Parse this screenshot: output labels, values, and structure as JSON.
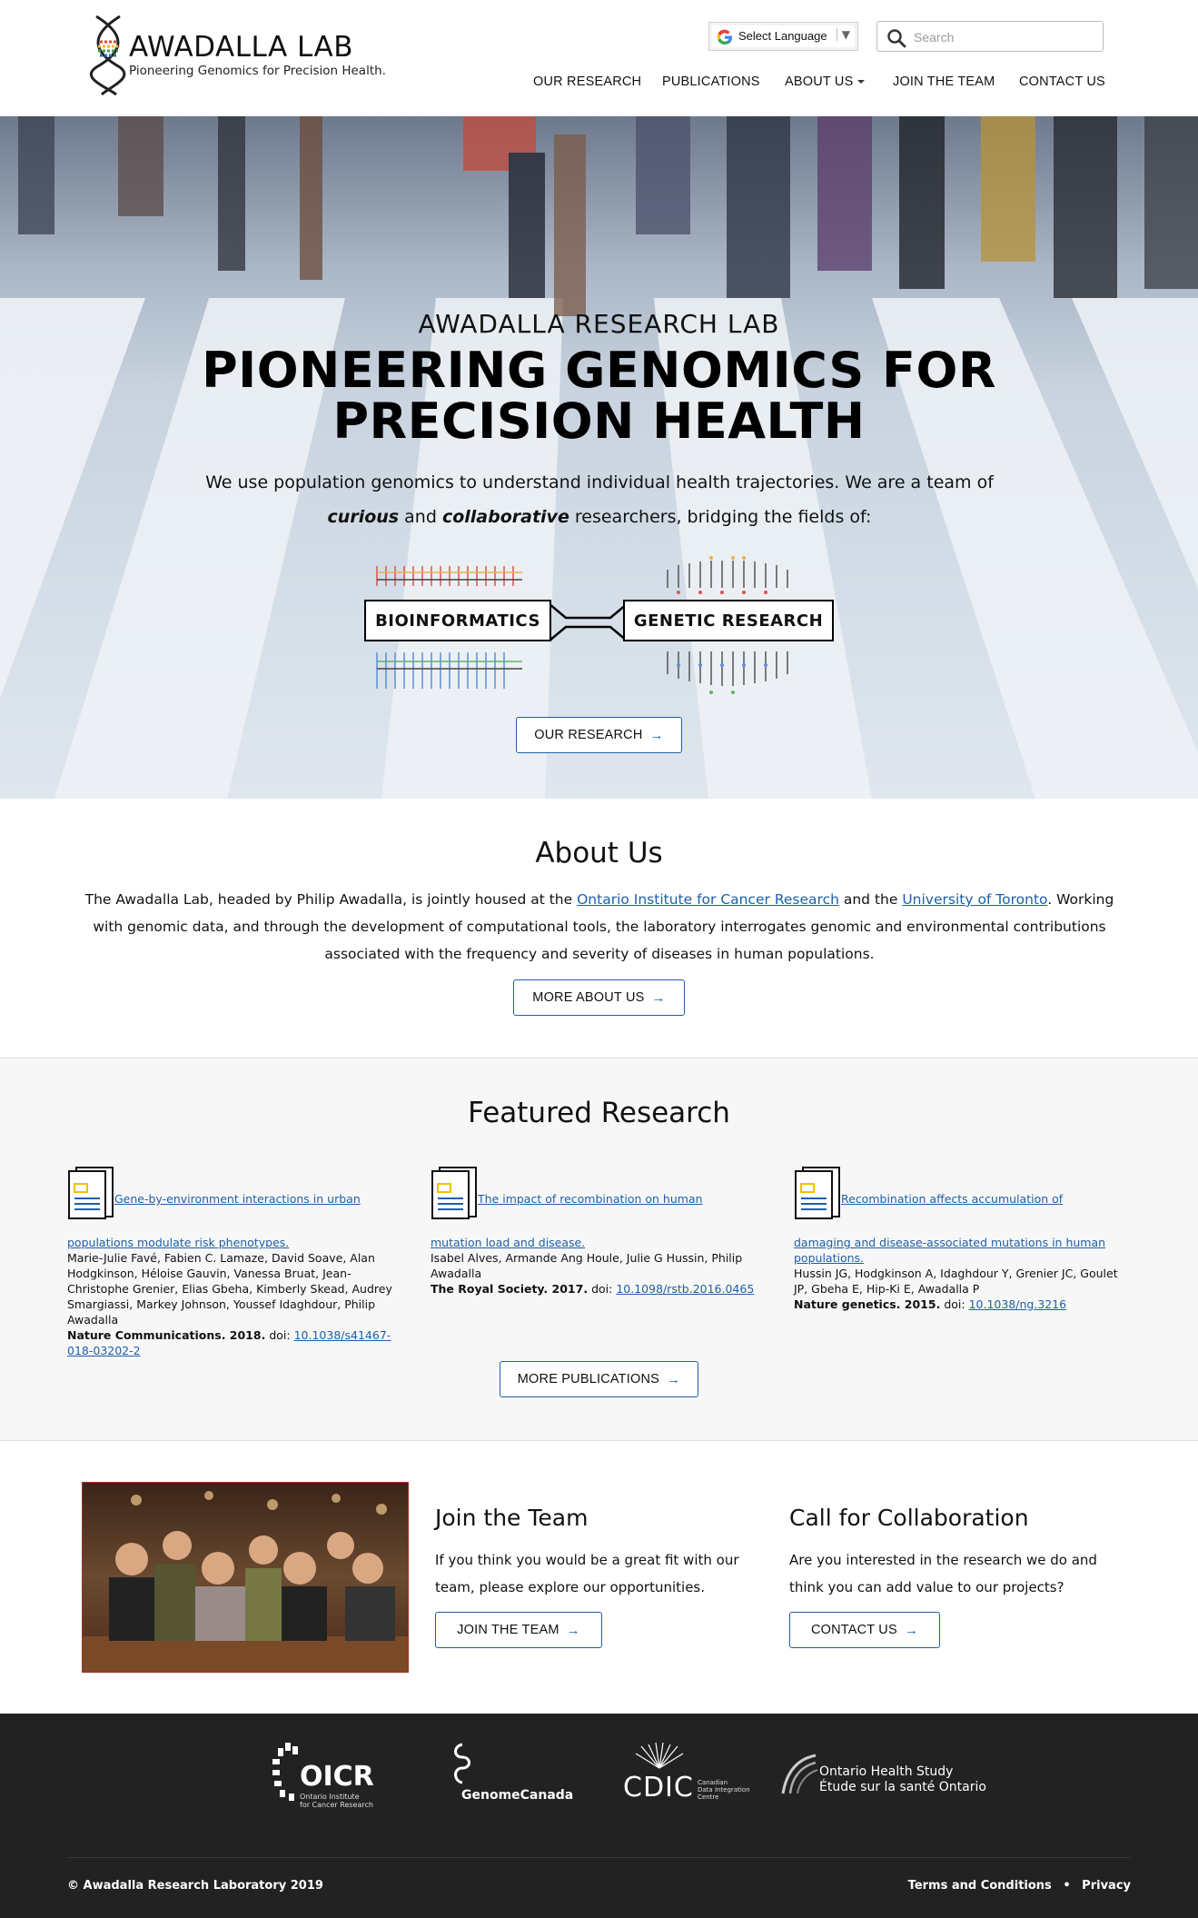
{
  "header": {
    "logo_title": "AWADALLA LAB",
    "logo_tagline": "Pioneering Genomics for Precision Health.",
    "language_label": "Select Language",
    "search_placeholder": "Search",
    "nav": {
      "research": "OUR RESEARCH",
      "publications": "PUBLICATIONS",
      "about": "ABOUT US",
      "join": "JOIN THE TEAM",
      "contact": "CONTACT US"
    }
  },
  "hero": {
    "subtitle": "AWADALLA RESEARCH LAB",
    "title_line1": "PIONEERING GENOMICS FOR",
    "title_line2": "PRECISION HEALTH",
    "lead_line1": "We use population genomics to understand individual health trajectories. We are a team of",
    "lead_curious": "curious",
    "lead_and": "and",
    "lead_collaborative": "collaborative",
    "lead_rest": "researchers, bridging the fields of:",
    "field_left": "BIOINFORMATICS",
    "field_right": "GENETIC RESEARCH",
    "button": "OUR RESEARCH"
  },
  "about": {
    "title": "About Us",
    "text_1": "The Awadalla Lab, headed by Philip Awadalla, is jointly housed at the",
    "link_oicr": "Ontario Institute for Cancer Research",
    "text_2": "and the",
    "link_uoft": "University of Toronto",
    "text_3": ". Working with genomic data, and through the development of computational tools, the laboratory interrogates genomic and environmental contributions associated with the frequency and severity of diseases in human populations.",
    "button": "MORE ABOUT US"
  },
  "featured": {
    "title": "Featured Research",
    "button": "MORE PUBLICATIONS",
    "pubs": [
      {
        "title_line1": "Gene-by-environment interactions in urban",
        "title_line2": "populations modulate risk phenotypes.",
        "authors": "Marie-Julie Favé, Fabien C. Lamaze, David Soave, Alan Hodgkinson, Héloise Gauvin, Vanessa Bruat, Jean-Christophe Grenier, Elias Gbeha, Kimberly Skead, Audrey Smargiassi, Markey Johnson, Youssef Idaghdour, Philip Awadalla",
        "journal": "Nature Communications. 2018.",
        "doi_label": "doi:",
        "doi": "10.1038/s41467-018-03202-2"
      },
      {
        "title_line1": "The impact of recombination on human",
        "title_line2": "mutation load and disease.",
        "authors": "Isabel Alves, Armande Ang Houle, Julie G Hussin, Philip Awadalla",
        "journal": "The Royal Society. 2017.",
        "doi_label": "doi:",
        "doi": "10.1098/rstb.2016.0465"
      },
      {
        "title_line1": "Recombination affects accumulation of",
        "title_line2": "damaging and disease-associated mutations in human populations.",
        "authors": "Hussin JG, Hodgkinson A, Idaghdour Y, Grenier JC, Goulet JP, Gbeha E, Hip-Ki E, Awadalla P",
        "journal": "Nature genetics. 2015.",
        "doi_label": "doi:",
        "doi": "10.1038/ng.3216"
      }
    ]
  },
  "join": {
    "title": "Join the Team",
    "text": "If you think you would be a great fit with our team, please explore our opportunities.",
    "button": "JOIN THE TEAM"
  },
  "collab": {
    "title": "Call for Collaboration",
    "text": "Are you interested in the research we do and think you can add value to our projects?",
    "button": "CONTACT US"
  },
  "footer": {
    "oicr_name": "OICR",
    "oicr_sub1": "Ontario Institute",
    "oicr_sub2": "for Cancer Research",
    "genome_name": "GenomeCanada",
    "cdic_name": "CDIC",
    "cdic_sub1": "Canadian",
    "cdic_sub2": "Data Integration",
    "cdic_sub3": "Centre",
    "ohs_line1": "Ontario Health Study",
    "ohs_line2": "Étude sur la santé Ontario",
    "copyright": "© Awadalla Research Laboratory 2019",
    "terms": "Terms and Conditions",
    "separator": "•",
    "privacy": "Privacy"
  }
}
